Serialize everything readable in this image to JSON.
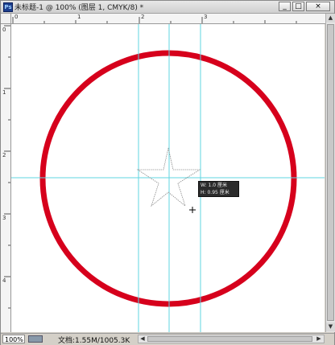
{
  "window": {
    "title": "未标题-1 @ 100% (图层 1, CMYK/8) *",
    "app_icon": "Ps",
    "minimize_icon": "minimize-icon",
    "maximize_icon": "maximize-icon",
    "close_icon": "close-icon",
    "minimize_symbol": "_",
    "maximize_symbol": "□",
    "close_symbol": "×"
  },
  "rulers": {
    "top_numbers": [
      "0",
      "1",
      "2",
      "3"
    ],
    "left_numbers": [
      "0",
      "1",
      "2",
      "3",
      "4"
    ]
  },
  "canvas": {
    "circle_color": "#d6001c",
    "guide_color": "#5fd6e0",
    "star_outline_color": "#8a8a8a"
  },
  "tooltip": {
    "w_label": "W:",
    "w_value": "1.0",
    "w_unit": "厘米",
    "h_label": "H:",
    "h_value": "0.95",
    "h_unit": "厘米"
  },
  "statusbar": {
    "zoom": "100%",
    "doc_info": "文档:1.55M/1005.3K",
    "left_arrow": "◀",
    "right_arrow": "▶"
  },
  "scroll": {
    "up_arrow": "▲",
    "down_arrow": "▼"
  }
}
